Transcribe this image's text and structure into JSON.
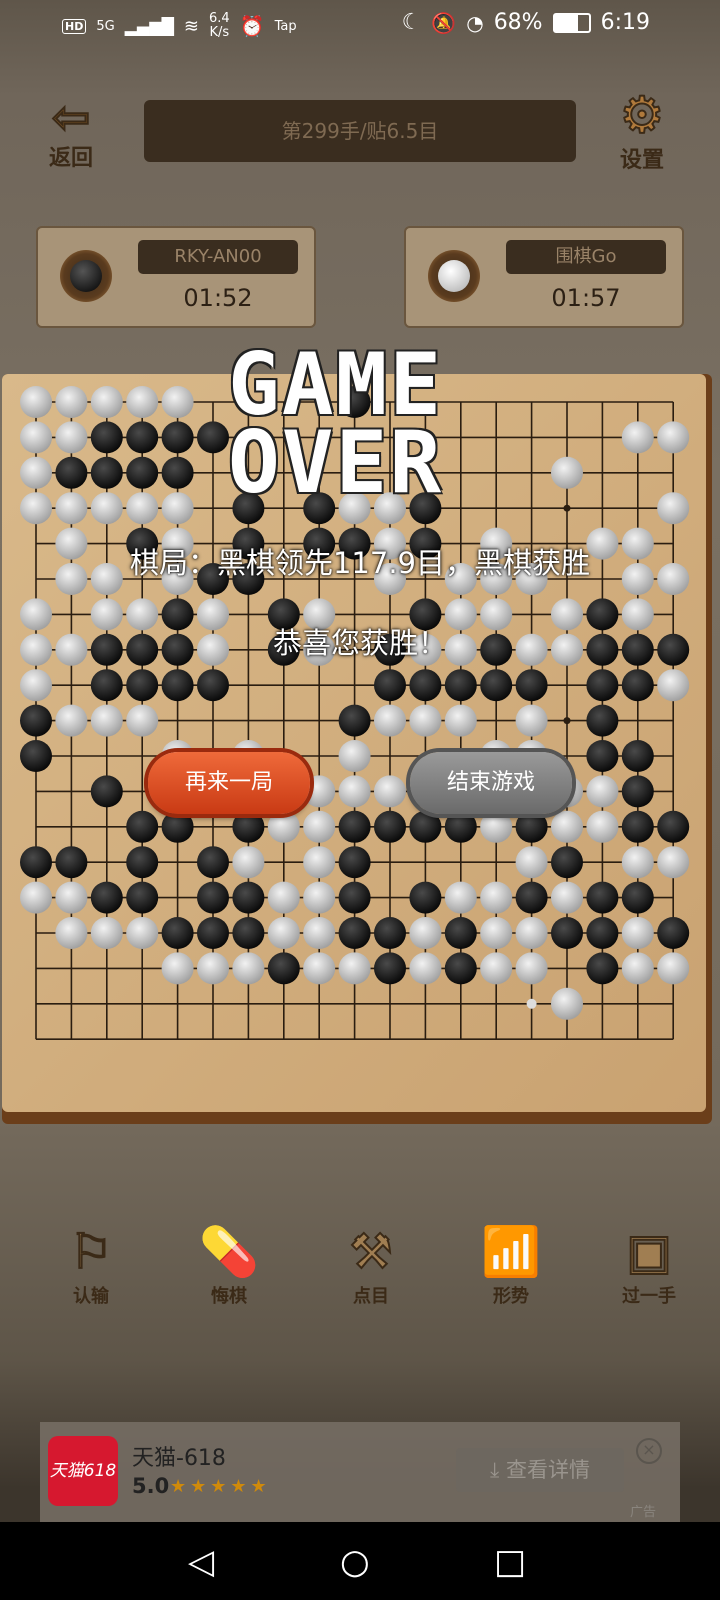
{
  "status_bar": {
    "hd": "HD",
    "network": "5G",
    "speed": "6.4",
    "speed_unit": "K/s",
    "tap": "Tap",
    "battery": "68%",
    "time": "6:19"
  },
  "header": {
    "back_label": "返回",
    "move_info": "第299手/贴6.5目",
    "settings_label": "设置"
  },
  "players": [
    {
      "name": "RKY-AN00",
      "time": "01:52",
      "stone": "black"
    },
    {
      "name": "围棋Go",
      "time": "01:57",
      "stone": "white"
    }
  ],
  "board": {
    "size": 19,
    "last_move": "H18",
    "rows": [
      "WWWWW....B.........W",
      "WWBBBB...........WW.",
      "WBBBB..........W...W",
      "WWWWW.B.BWWB......W.",
      ".W.BW.B.BBWB.W..WW..",
      ".WW.WBB...W.WWW..WW",
      "W.WWBW.BW..BWW.WBW.B",
      "WWBBBW.BW.BWWBWWBBBB",
      "W.BBBB....BBBBB.BBW.",
      "BWWW.....BWWW.W.B...",
      "B...W.W..W...WW.BB..",
      "..B.BBW.WWWBBWBWWB..B",
      "...BB.BWWBBBBWBWWBBBW",
      "BB.B.BW.WB....WB.WWW",
      "WWBB.BBWWB.BWWBWBB..",
      ".WWWBBBWWBBWBWWBBWB.",
      "....WWWBWWBWBWW.BWWB.",
      "...............W......"
    ]
  },
  "overlay": {
    "title_line1": "GAME",
    "title_line2": "OVER",
    "result": "棋局：黑棋领先117.9目，黑棋获胜",
    "congrats": "恭喜您获胜！",
    "again_label": "再来一局",
    "end_label": "结束游戏"
  },
  "tools": [
    {
      "label": "认输",
      "icon": "flag-icon"
    },
    {
      "label": "悔棋",
      "icon": "pills-icon"
    },
    {
      "label": "点目",
      "icon": "gavel-icon"
    },
    {
      "label": "形势",
      "icon": "chart-icon"
    },
    {
      "label": "过一手",
      "icon": "skip-icon"
    }
  ],
  "ad": {
    "logo_text": "天猫618",
    "title": "天猫-618",
    "rating": "5.0",
    "cta": "查看详情",
    "tag": "广告"
  }
}
